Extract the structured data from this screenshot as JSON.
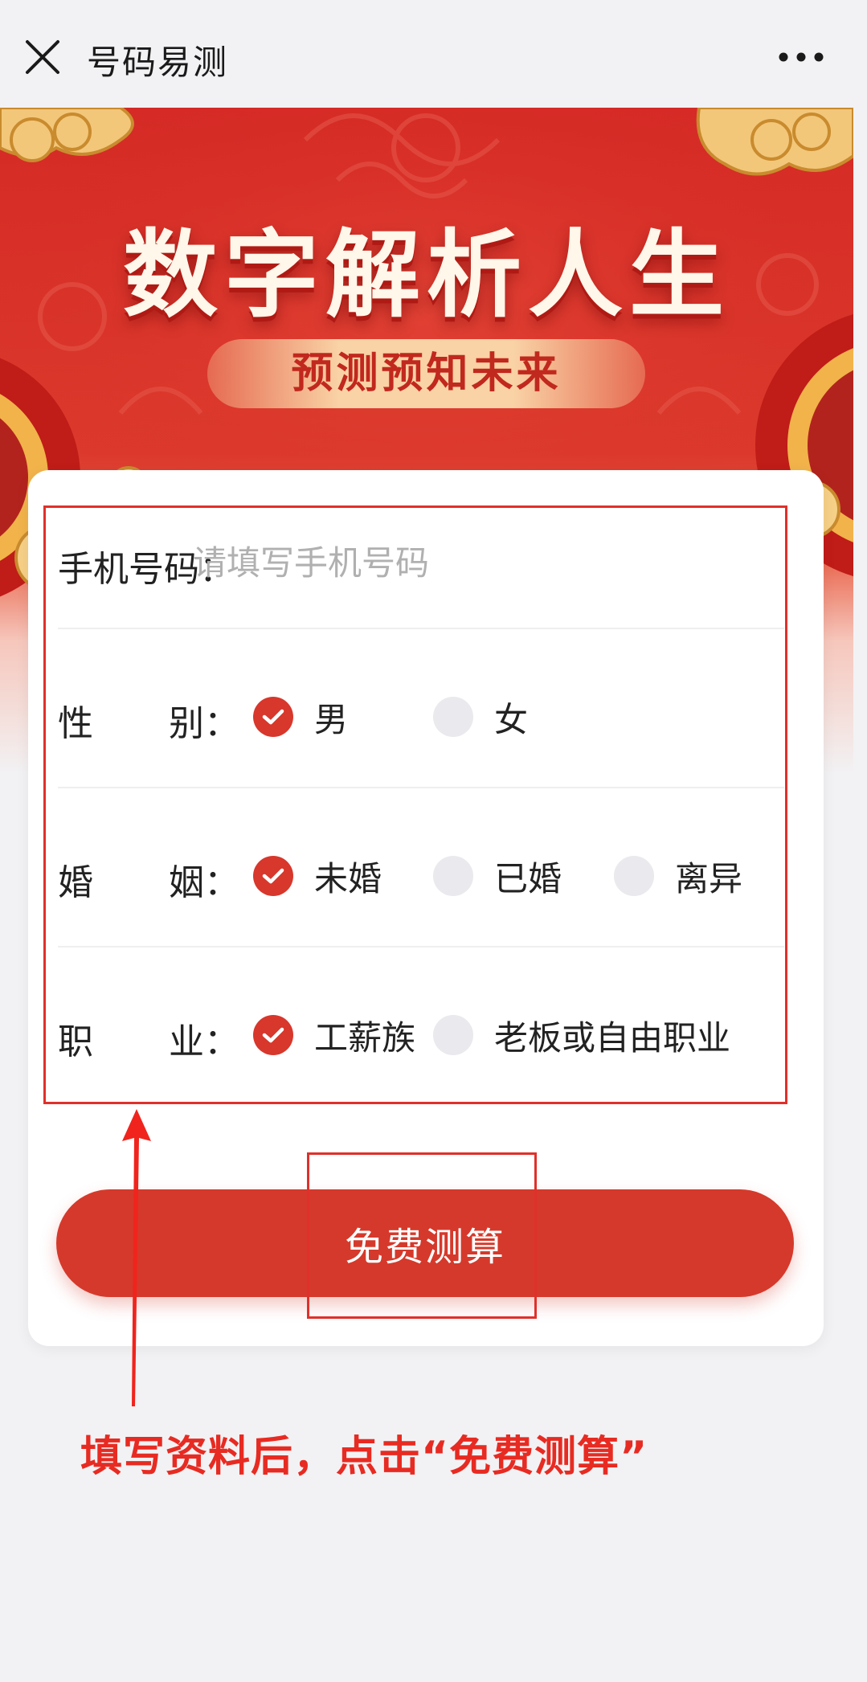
{
  "nav": {
    "title": "号码易测",
    "close_icon": "close-icon",
    "more_icon": "more-icon"
  },
  "banner": {
    "title": "数字解析人生",
    "subtitle": "预测预知未来"
  },
  "form": {
    "phone": {
      "label": "手机号码：",
      "placeholder": "请填写手机号码",
      "value": ""
    },
    "gender": {
      "label_a": "性",
      "label_b": "别：",
      "options": [
        "男",
        "女"
      ],
      "selected": "男"
    },
    "marriage": {
      "label_a": "婚",
      "label_b": "姻：",
      "options": [
        "未婚",
        "已婚",
        "离异"
      ],
      "selected": "未婚"
    },
    "job": {
      "label_a": "职",
      "label_b": "业：",
      "options": [
        "工薪族",
        "老板或自由职业"
      ],
      "selected": "工薪族"
    }
  },
  "submit_label": "免费测算",
  "instruction": "填写资料后，点击“免费测算”",
  "colors": {
    "accent": "#d5392b",
    "annotation": "#e72b22",
    "banner": "#d52a25"
  }
}
